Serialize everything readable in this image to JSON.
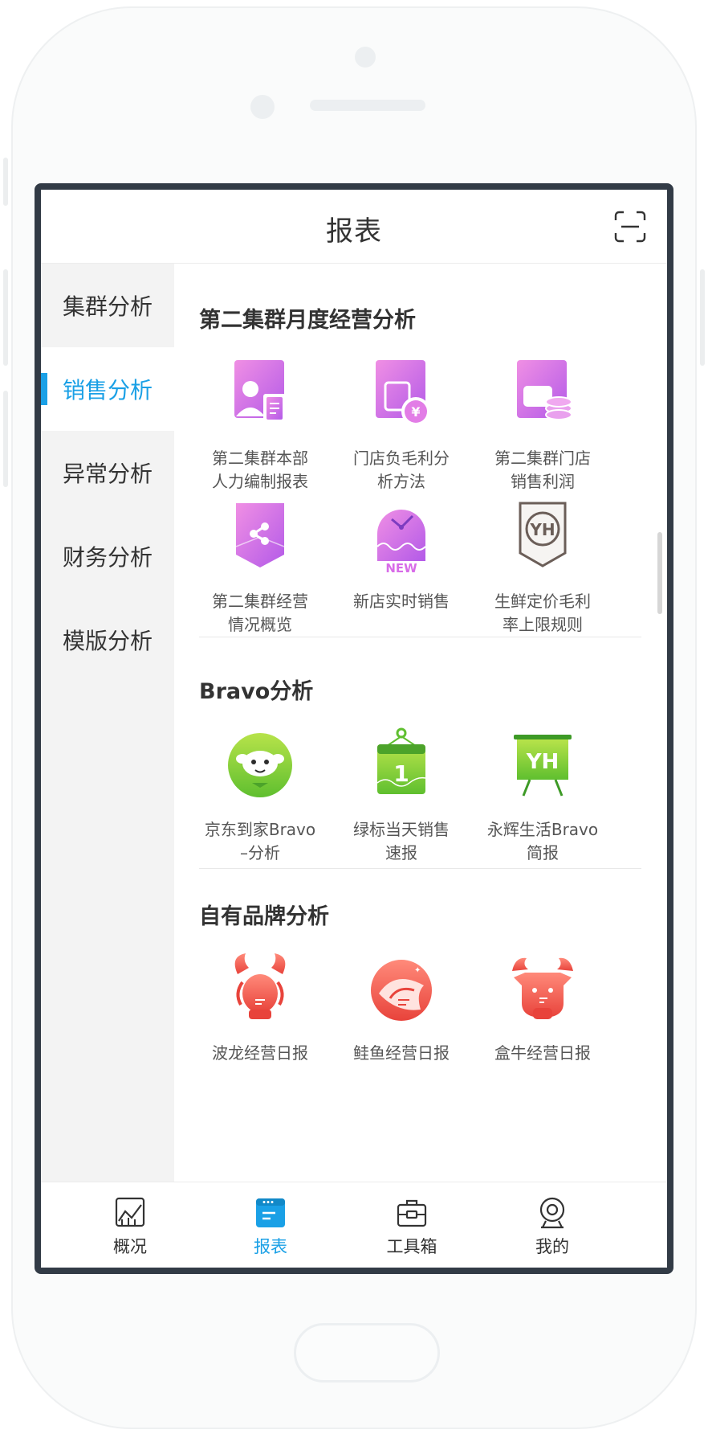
{
  "header": {
    "title": "报表"
  },
  "icons": {
    "scan": "scan-icon"
  },
  "sidebar": {
    "items": [
      {
        "label": "集群分析",
        "active": false
      },
      {
        "label": "销售分析",
        "active": true
      },
      {
        "label": "异常分析",
        "active": false
      },
      {
        "label": "财务分析",
        "active": false
      },
      {
        "label": "模版分析",
        "active": false
      }
    ]
  },
  "sections": [
    {
      "title": "第二集群月度经营分析",
      "items": [
        {
          "label": "第二集群本部\n人力编制报表",
          "icon": "person-document-icon"
        },
        {
          "label": "门店负毛利分\n析方法",
          "icon": "yuan-card-icon"
        },
        {
          "label": "第二集群门店\n销售利润",
          "icon": "coin-stack-icon"
        },
        {
          "label": "第二集群经营\n情况概览",
          "icon": "share-badge-icon"
        },
        {
          "label": "新店实时销售",
          "icon": "new-clock-icon"
        },
        {
          "label": "生鲜定价毛利\n率上限规则",
          "icon": "yh-shield-icon"
        }
      ]
    },
    {
      "title": "Bravo分析",
      "items": [
        {
          "label": "京东到家Bravo\n–分析",
          "icon": "jd-mascot-icon"
        },
        {
          "label": "绿标当天销售\n速报",
          "icon": "calendar-chart-icon"
        },
        {
          "label": "永辉生活Bravo\n简报",
          "icon": "yh-board-icon"
        }
      ]
    },
    {
      "title": "自有品牌分析",
      "items": [
        {
          "label": "波龙经营日报",
          "icon": "lobster-icon"
        },
        {
          "label": "鲑鱼经营日报",
          "icon": "salmon-icon"
        },
        {
          "label": "盒牛经营日报",
          "icon": "cow-icon"
        }
      ]
    }
  ],
  "bottom_nav": [
    {
      "label": "概况",
      "icon": "overview-chart-icon",
      "active": false
    },
    {
      "label": "报表",
      "icon": "report-icon",
      "active": true
    },
    {
      "label": "工具箱",
      "icon": "toolbox-icon",
      "active": false
    },
    {
      "label": "我的",
      "icon": "profile-icon",
      "active": false
    }
  ],
  "colors": {
    "accent": "#1aa0e6",
    "frame": "#323b46",
    "sidebar_bg": "#f3f3f3"
  }
}
